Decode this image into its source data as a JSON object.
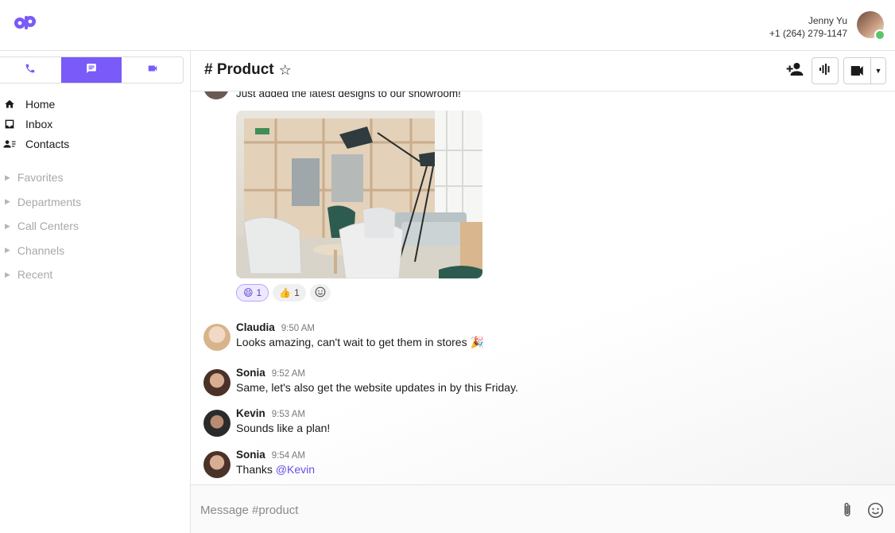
{
  "user": {
    "name": "Jenny Yu",
    "phone": "+1 (264) 279-1147"
  },
  "mode_tabs": [
    {
      "id": "calls",
      "icon": "phone-icon"
    },
    {
      "id": "messages",
      "icon": "chat-icon",
      "active": true
    },
    {
      "id": "video",
      "icon": "video-camera-icon"
    }
  ],
  "nav": {
    "home": "Home",
    "inbox": "Inbox",
    "contacts": "Contacts"
  },
  "groups": {
    "favorites": "Favorites",
    "departments": "Departments",
    "call_centers": "Call Centers",
    "channels": "Channels",
    "recent": "Recent"
  },
  "channel": {
    "title": "# Product"
  },
  "feed": {
    "partial_message": "Just added the latest designs to our showroom!",
    "reactions": [
      {
        "emoji": "😄",
        "count": "1",
        "mine": true
      },
      {
        "emoji": "👍",
        "count": "1",
        "mine": false
      }
    ],
    "messages": [
      {
        "name": "Claudia",
        "time": "9:50 AM",
        "text": "Looks amazing, can't wait to get them in stores 🎉"
      },
      {
        "name": "Sonia",
        "time": "9:52 AM",
        "text": "Same, let's also get the website updates in by this Friday."
      },
      {
        "name": "Kevin",
        "time": "9:53 AM",
        "text": "Sounds like a plan!"
      },
      {
        "name": "Sonia",
        "time": "9:54 AM",
        "text_prefix": "Thanks ",
        "mention": "@Kevin"
      }
    ]
  },
  "composer": {
    "placeholder": "Message #product"
  },
  "colors": {
    "accent": "#7a5af8",
    "presence": "#5bc46b",
    "mention": "#6b4ee6"
  }
}
